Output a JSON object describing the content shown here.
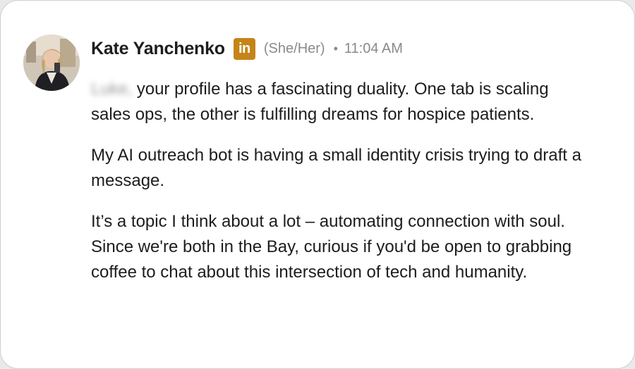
{
  "sender": {
    "name": "Kate Yanchenko",
    "badge_text": "in",
    "badge_color": "#c58418",
    "pronouns": "(She/Her)",
    "separator": "•",
    "time": "11:04 AM",
    "avatar_icon": "profile-photo"
  },
  "message": {
    "recipient_name_blurred": "Luke,",
    "paragraph_1_rest": "your profile has a fascinating duality. One tab is scaling sales ops, the other is fulfilling dreams for hospice patients.",
    "paragraph_2": "My AI outreach bot is having a small identity crisis trying to draft a message.",
    "paragraph_3": "It’s a topic I think about a lot – automating connection with soul. Since we're both in the Bay, curious if you'd be open to grabbing coffee to chat about this intersection of tech and humanity."
  }
}
